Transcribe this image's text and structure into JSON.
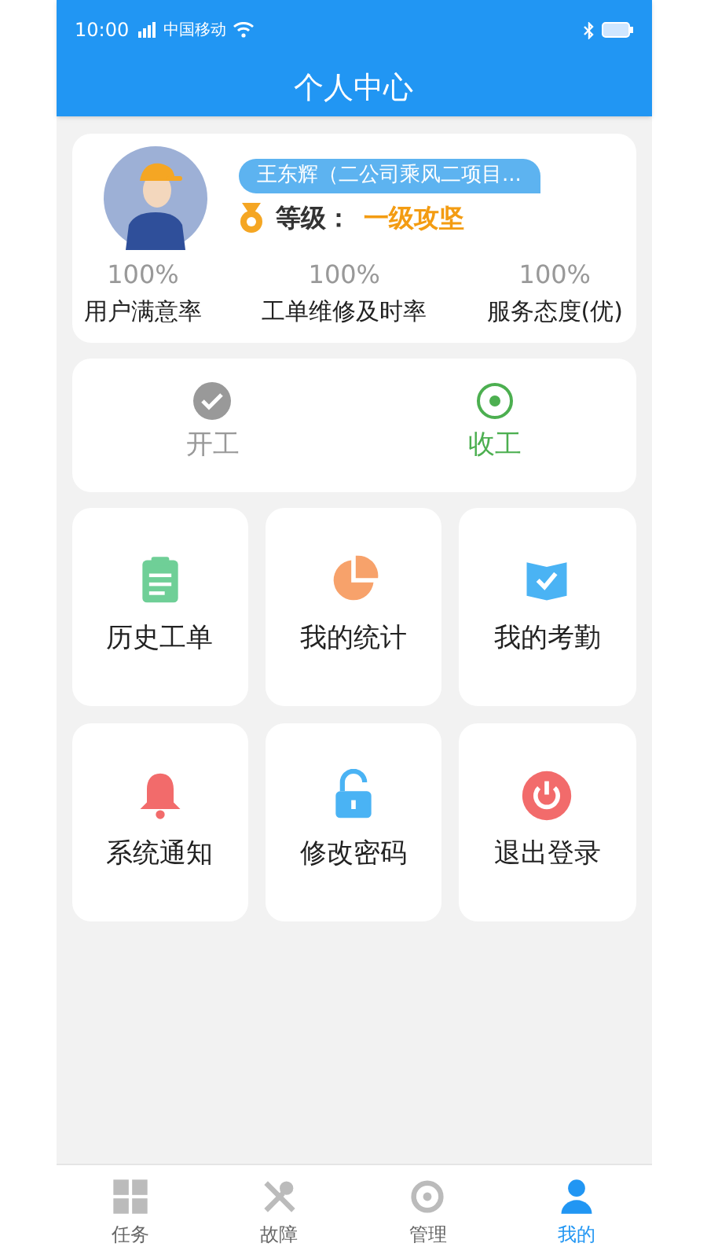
{
  "status_bar": {
    "time": "10:00",
    "carrier": "中国移动"
  },
  "header": {
    "title": "个人中心"
  },
  "profile": {
    "name": "王东辉（二公司乘风二项目...",
    "level_label": "等级：",
    "level_value": "一级攻坚",
    "stats": [
      {
        "value": "100%",
        "label": "用户满意率"
      },
      {
        "value": "100%",
        "label": "工单维修及时率"
      },
      {
        "value": "100%",
        "label": "服务态度(优)"
      }
    ]
  },
  "work_toggle": [
    {
      "kind": "check",
      "label": "开工",
      "selected": false
    },
    {
      "kind": "radio",
      "label": "收工",
      "selected": true
    }
  ],
  "menu": [
    {
      "kind": "clipboard",
      "label": "历史工单",
      "color": "#6fcf97"
    },
    {
      "kind": "pie",
      "label": "我的统计",
      "color": "#f7a26b"
    },
    {
      "kind": "book",
      "label": "我的考勤",
      "color": "#4ab3f4"
    },
    {
      "kind": "bell",
      "label": "系统通知",
      "color": "#f26b6b"
    },
    {
      "kind": "lock",
      "label": "修改密码",
      "color": "#4ab3f4"
    },
    {
      "kind": "power",
      "label": "退出登录",
      "color": "#f26b6b"
    }
  ],
  "tab_bar": [
    {
      "kind": "grid",
      "label": "任务",
      "selected": false
    },
    {
      "kind": "tools",
      "label": "故障",
      "selected": false
    },
    {
      "kind": "manage",
      "label": "管理",
      "selected": false
    },
    {
      "kind": "person",
      "label": "我的",
      "selected": true
    }
  ]
}
